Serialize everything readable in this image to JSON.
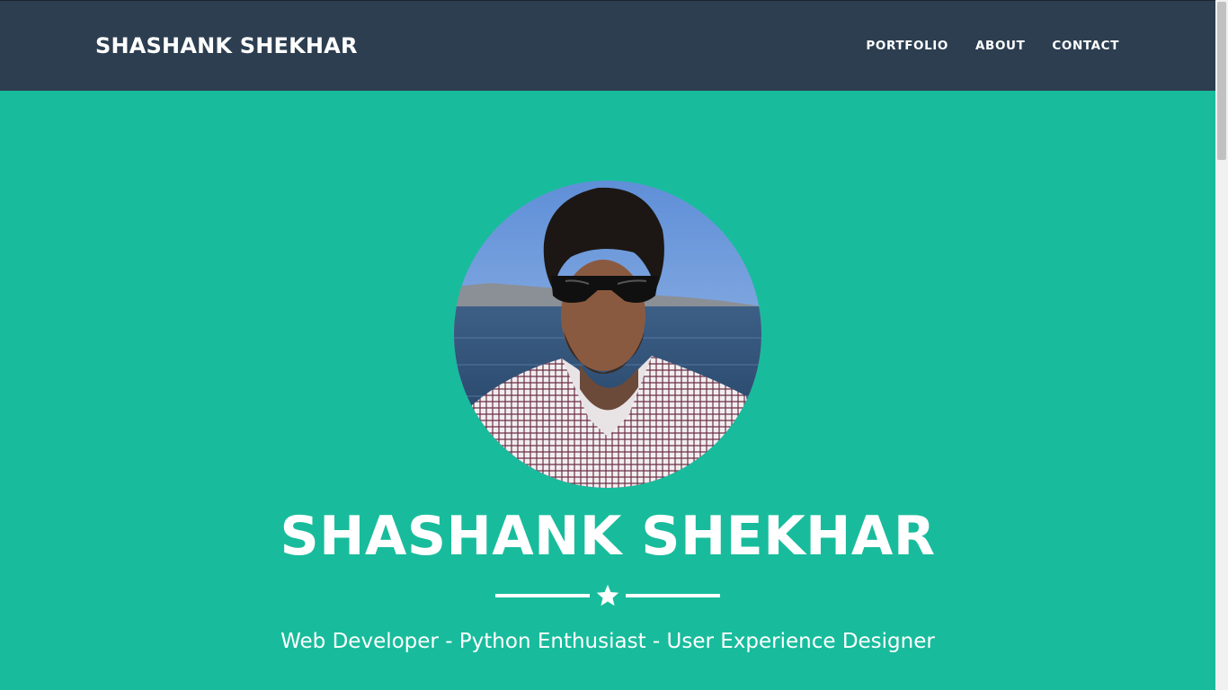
{
  "navbar": {
    "brand": "SHASHANK SHEKHAR",
    "links": [
      {
        "label": "PORTFOLIO"
      },
      {
        "label": "ABOUT"
      },
      {
        "label": "CONTACT"
      }
    ]
  },
  "hero": {
    "name": "SHASHANK SHEKHAR",
    "tagline": "Web Developer - Python Enthusiast - User Experience Designer",
    "divider_icon": "star-icon"
  },
  "colors": {
    "navbar_bg": "#2c3e50",
    "hero_bg": "#18bc9c",
    "text": "#ffffff"
  }
}
